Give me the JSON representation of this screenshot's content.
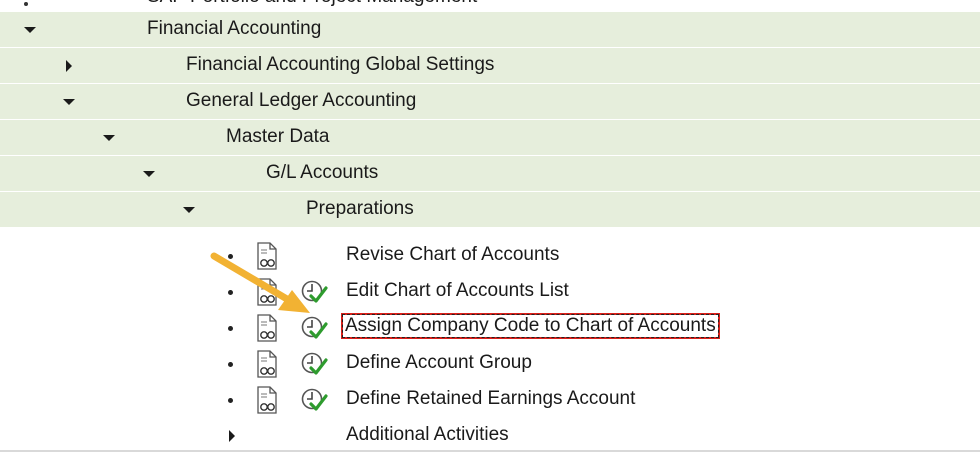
{
  "tree": {
    "partial_top_label": "SAP Portfolio and Project Management",
    "nodes": [
      {
        "label": "Financial Accounting",
        "state": "expanded"
      },
      {
        "label": "Financial Accounting Global Settings",
        "state": "collapsed"
      },
      {
        "label": "General Ledger Accounting",
        "state": "expanded"
      },
      {
        "label": "Master Data",
        "state": "expanded"
      },
      {
        "label": "G/L Accounts",
        "state": "expanded"
      },
      {
        "label": "Preparations",
        "state": "expanded"
      },
      {
        "label": "Revise Chart of Accounts",
        "state": "leaf",
        "icons": [
          "documentation-icon"
        ]
      },
      {
        "label": "Edit Chart of Accounts List",
        "state": "leaf",
        "icons": [
          "documentation-icon",
          "execute-clock-check-icon"
        ]
      },
      {
        "label": "Assign Company Code to Chart of Accounts",
        "state": "leaf",
        "selected": true,
        "icons": [
          "documentation-icon",
          "execute-clock-check-icon"
        ]
      },
      {
        "label": "Define Account Group",
        "state": "leaf",
        "icons": [
          "documentation-icon",
          "execute-clock-check-icon"
        ]
      },
      {
        "label": "Define Retained Earnings Account",
        "state": "leaf",
        "icons": [
          "documentation-icon",
          "execute-clock-check-icon"
        ]
      },
      {
        "label": "Additional Activities",
        "state": "collapsed"
      }
    ]
  },
  "colors": {
    "row_highlight": "#e6eedc",
    "selection_border": "#d9201a",
    "annotation_arrow": "#f2b233",
    "check_green": "#2e9b2e"
  }
}
